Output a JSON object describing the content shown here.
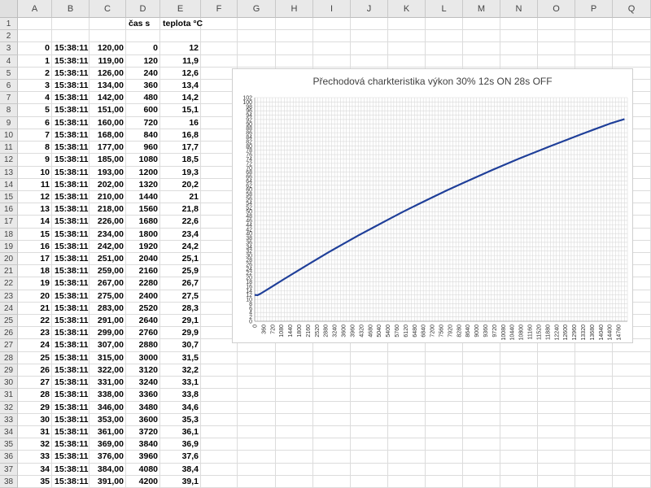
{
  "columns": [
    "A",
    "B",
    "C",
    "D",
    "E",
    "F",
    "G",
    "H",
    "I",
    "J",
    "K",
    "L",
    "M",
    "N",
    "O",
    "P",
    "Q"
  ],
  "header_row": {
    "d": "čas s",
    "e": "teplota °C"
  },
  "rows": [
    {
      "r": "3",
      "a": "0",
      "b": "15:38:11",
      "c": "120,00",
      "d": "0",
      "e": "12"
    },
    {
      "r": "4",
      "a": "1",
      "b": "15:38:11",
      "c": "119,00",
      "d": "120",
      "e": "11,9"
    },
    {
      "r": "5",
      "a": "2",
      "b": "15:38:11",
      "c": "126,00",
      "d": "240",
      "e": "12,6"
    },
    {
      "r": "6",
      "a": "3",
      "b": "15:38:11",
      "c": "134,00",
      "d": "360",
      "e": "13,4"
    },
    {
      "r": "7",
      "a": "4",
      "b": "15:38:11",
      "c": "142,00",
      "d": "480",
      "e": "14,2"
    },
    {
      "r": "8",
      "a": "5",
      "b": "15:38:11",
      "c": "151,00",
      "d": "600",
      "e": "15,1"
    },
    {
      "r": "9",
      "a": "6",
      "b": "15:38:11",
      "c": "160,00",
      "d": "720",
      "e": "16"
    },
    {
      "r": "10",
      "a": "7",
      "b": "15:38:11",
      "c": "168,00",
      "d": "840",
      "e": "16,8"
    },
    {
      "r": "11",
      "a": "8",
      "b": "15:38:11",
      "c": "177,00",
      "d": "960",
      "e": "17,7"
    },
    {
      "r": "12",
      "a": "9",
      "b": "15:38:11",
      "c": "185,00",
      "d": "1080",
      "e": "18,5"
    },
    {
      "r": "13",
      "a": "10",
      "b": "15:38:11",
      "c": "193,00",
      "d": "1200",
      "e": "19,3"
    },
    {
      "r": "14",
      "a": "11",
      "b": "15:38:11",
      "c": "202,00",
      "d": "1320",
      "e": "20,2"
    },
    {
      "r": "15",
      "a": "12",
      "b": "15:38:11",
      "c": "210,00",
      "d": "1440",
      "e": "21"
    },
    {
      "r": "16",
      "a": "13",
      "b": "15:38:11",
      "c": "218,00",
      "d": "1560",
      "e": "21,8"
    },
    {
      "r": "17",
      "a": "14",
      "b": "15:38:11",
      "c": "226,00",
      "d": "1680",
      "e": "22,6"
    },
    {
      "r": "18",
      "a": "15",
      "b": "15:38:11",
      "c": "234,00",
      "d": "1800",
      "e": "23,4"
    },
    {
      "r": "19",
      "a": "16",
      "b": "15:38:11",
      "c": "242,00",
      "d": "1920",
      "e": "24,2"
    },
    {
      "r": "20",
      "a": "17",
      "b": "15:38:11",
      "c": "251,00",
      "d": "2040",
      "e": "25,1"
    },
    {
      "r": "21",
      "a": "18",
      "b": "15:38:11",
      "c": "259,00",
      "d": "2160",
      "e": "25,9"
    },
    {
      "r": "22",
      "a": "19",
      "b": "15:38:11",
      "c": "267,00",
      "d": "2280",
      "e": "26,7"
    },
    {
      "r": "23",
      "a": "20",
      "b": "15:38:11",
      "c": "275,00",
      "d": "2400",
      "e": "27,5"
    },
    {
      "r": "24",
      "a": "21",
      "b": "15:38:11",
      "c": "283,00",
      "d": "2520",
      "e": "28,3"
    },
    {
      "r": "25",
      "a": "22",
      "b": "15:38:11",
      "c": "291,00",
      "d": "2640",
      "e": "29,1"
    },
    {
      "r": "26",
      "a": "23",
      "b": "15:38:11",
      "c": "299,00",
      "d": "2760",
      "e": "29,9"
    },
    {
      "r": "27",
      "a": "24",
      "b": "15:38:11",
      "c": "307,00",
      "d": "2880",
      "e": "30,7"
    },
    {
      "r": "28",
      "a": "25",
      "b": "15:38:11",
      "c": "315,00",
      "d": "3000",
      "e": "31,5"
    },
    {
      "r": "29",
      "a": "26",
      "b": "15:38:11",
      "c": "322,00",
      "d": "3120",
      "e": "32,2"
    },
    {
      "r": "30",
      "a": "27",
      "b": "15:38:11",
      "c": "331,00",
      "d": "3240",
      "e": "33,1"
    },
    {
      "r": "31",
      "a": "28",
      "b": "15:38:11",
      "c": "338,00",
      "d": "3360",
      "e": "33,8"
    },
    {
      "r": "32",
      "a": "29",
      "b": "15:38:11",
      "c": "346,00",
      "d": "3480",
      "e": "34,6"
    },
    {
      "r": "33",
      "a": "30",
      "b": "15:38:11",
      "c": "353,00",
      "d": "3600",
      "e": "35,3"
    },
    {
      "r": "34",
      "a": "31",
      "b": "15:38:11",
      "c": "361,00",
      "d": "3720",
      "e": "36,1"
    },
    {
      "r": "35",
      "a": "32",
      "b": "15:38:11",
      "c": "369,00",
      "d": "3840",
      "e": "36,9"
    },
    {
      "r": "36",
      "a": "33",
      "b": "15:38:11",
      "c": "376,00",
      "d": "3960",
      "e": "37,6"
    },
    {
      "r": "37",
      "a": "34",
      "b": "15:38:11",
      "c": "384,00",
      "d": "4080",
      "e": "38,4"
    },
    {
      "r": "38",
      "a": "35",
      "b": "15:38:11",
      "c": "391,00",
      "d": "4200",
      "e": "39,1"
    }
  ],
  "chart_data": {
    "type": "line",
    "title": "Přechodová charkteristika výkon 30% 12s ON 28s OFF",
    "xlabel": "",
    "ylabel": "",
    "xlim": [
      0,
      15120
    ],
    "ylim": [
      0,
      102
    ],
    "x_ticks": [
      "0",
      "360",
      "720",
      "1080",
      "1440",
      "1800",
      "2160",
      "2520",
      "2880",
      "3240",
      "3600",
      "3960",
      "4320",
      "4680",
      "5040",
      "5400",
      "5760",
      "6120",
      "6480",
      "6840",
      "7200",
      "7560",
      "7920",
      "8280",
      "8640",
      "9000",
      "9360",
      "9720",
      "10080",
      "10440",
      "10800",
      "11160",
      "11520",
      "11880",
      "12240",
      "12600",
      "12960",
      "13320",
      "13680",
      "14040",
      "14400",
      "14760"
    ],
    "y_ticks": [
      "0",
      "2",
      "4",
      "6",
      "8",
      "10",
      "12",
      "14",
      "16",
      "18",
      "20",
      "22",
      "24",
      "26",
      "28",
      "30",
      "32",
      "34",
      "36",
      "38",
      "40",
      "42",
      "44",
      "46",
      "48",
      "50",
      "52",
      "54",
      "56",
      "58",
      "60",
      "62",
      "64",
      "66",
      "68",
      "70",
      "72",
      "74",
      "76",
      "78",
      "80",
      "82",
      "84",
      "86",
      "88",
      "90",
      "92",
      "94",
      "96",
      "98",
      "100",
      "102"
    ],
    "grid": true,
    "color": "#1f3f99",
    "series": [
      {
        "x": [
          0,
          120,
          240,
          600,
          1200,
          1800,
          2400,
          3000,
          3600,
          4200,
          4800,
          5400,
          6000,
          6600,
          7200,
          7800,
          8400,
          9000,
          9600,
          10200,
          10800,
          11400,
          12000,
          12600,
          13200,
          13800,
          14400,
          15000
        ],
        "y": [
          12,
          11.9,
          12.6,
          15.1,
          19.3,
          23.4,
          27.5,
          31.5,
          35.3,
          39.1,
          42.7,
          46.3,
          49.8,
          53.2,
          56.5,
          59.7,
          62.8,
          65.8,
          68.8,
          71.7,
          74.5,
          77.2,
          79.9,
          82.5,
          85.1,
          87.6,
          90.1,
          92.2
        ]
      }
    ]
  }
}
